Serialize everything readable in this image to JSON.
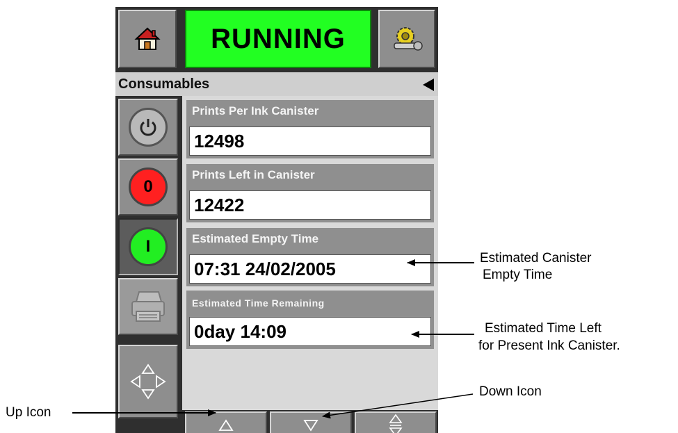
{
  "header": {
    "status": "RUNNING",
    "status_color": "#22ff22",
    "home_icon": "home-icon",
    "settings_icon": "settings-gear-icon"
  },
  "title_bar": {
    "title": "Consumables",
    "back_icon": "back-arrow-icon"
  },
  "side_buttons": [
    {
      "name": "power-button",
      "icon": "power-icon"
    },
    {
      "name": "stop-button",
      "label": "0",
      "color": "#ff2020"
    },
    {
      "name": "start-button",
      "label": "I",
      "color": "#22ee22"
    },
    {
      "name": "print-button",
      "icon": "printer-icon",
      "disabled": true
    },
    {
      "name": "navigation-button",
      "icon": "four-way-arrows-icon"
    }
  ],
  "fields": [
    {
      "label": "Prints Per Ink Canister",
      "value": "12498"
    },
    {
      "label": "Prints Left in Canister",
      "value": "12422"
    },
    {
      "label": "Estimated Empty Time",
      "value": "07:31 24/02/2005"
    },
    {
      "label": "Estimated Time Remaining",
      "value": "0day 14:09"
    }
  ],
  "bottom_buttons": [
    {
      "name": "up-button",
      "icon": "up-triangle-icon"
    },
    {
      "name": "down-button",
      "icon": "down-triangle-icon"
    },
    {
      "name": "scroll-button",
      "icon": "up-down-arrows-icon"
    }
  ],
  "annotations": {
    "empty_time_line1": "Estimated Canister",
    "empty_time_line2": "Empty Time",
    "time_left_line1": "Estimated Time Left",
    "time_left_line2": "for Present Ink Canister.",
    "down_icon": "Down Icon",
    "up_icon": "Up Icon"
  }
}
